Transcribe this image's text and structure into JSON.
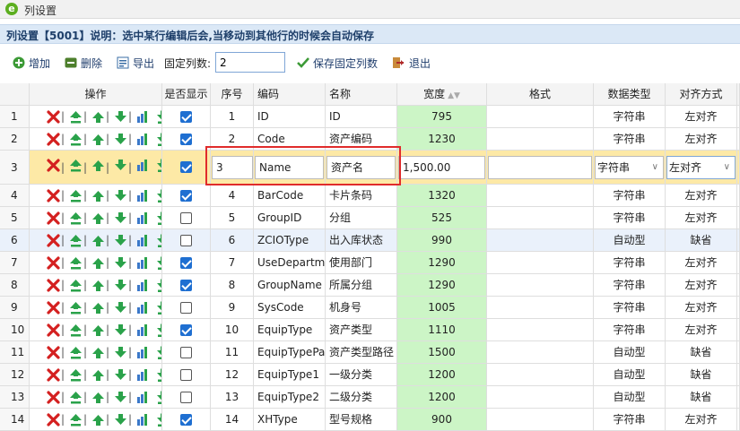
{
  "window": {
    "title": "列设置"
  },
  "info": {
    "text": "列设置【5001】说明：选中某行编辑后会,当移动到其他行的时候会自动保存"
  },
  "toolbar": {
    "add": "增加",
    "delete": "删除",
    "export": "导出",
    "fixed_label": "固定列数:",
    "fixed_value": "2",
    "save_fixed": "保存固定列数",
    "exit": "退出"
  },
  "headers": {
    "op": "操作",
    "show": "是否显示",
    "seq": "序号",
    "code": "编码",
    "name": "名称",
    "width": "宽度",
    "format": "格式",
    "datatype": "数据类型",
    "align": "对齐方式"
  },
  "rows": [
    {
      "idx": "1",
      "checked": true,
      "seq": "1",
      "code": "ID",
      "name": "ID",
      "width": "795",
      "format": "",
      "type": "字符串",
      "align": "左对齐"
    },
    {
      "idx": "2",
      "checked": true,
      "seq": "2",
      "code": "Code",
      "name": "资产编码",
      "width": "1230",
      "format": "",
      "type": "字符串",
      "align": "左对齐"
    },
    {
      "idx": "3",
      "checked": true,
      "seq": "3",
      "code": "Name",
      "name": "资产名",
      "width": "1,500.00",
      "format": "",
      "type": "字符串",
      "align": "左对齐",
      "editing": true
    },
    {
      "idx": "4",
      "checked": true,
      "seq": "4",
      "code": "BarCode",
      "name": "卡片条码",
      "width": "1320",
      "format": "",
      "type": "字符串",
      "align": "左对齐"
    },
    {
      "idx": "5",
      "checked": false,
      "seq": "5",
      "code": "GroupID",
      "name": "分组",
      "width": "525",
      "format": "",
      "type": "字符串",
      "align": "左对齐"
    },
    {
      "idx": "6",
      "checked": false,
      "seq": "6",
      "code": "ZCIOType",
      "name": "出入库状态",
      "width": "990",
      "format": "",
      "type": "自动型",
      "align": "缺省",
      "hl": true
    },
    {
      "idx": "7",
      "checked": true,
      "seq": "7",
      "code": "UseDepartm",
      "name": "使用部门",
      "width": "1290",
      "format": "",
      "type": "字符串",
      "align": "左对齐"
    },
    {
      "idx": "8",
      "checked": true,
      "seq": "8",
      "code": "GroupName",
      "name": "所属分组",
      "width": "1290",
      "format": "",
      "type": "字符串",
      "align": "左对齐"
    },
    {
      "idx": "9",
      "checked": false,
      "seq": "9",
      "code": "SysCode",
      "name": "机身号",
      "width": "1005",
      "format": "",
      "type": "字符串",
      "align": "左对齐"
    },
    {
      "idx": "10",
      "checked": true,
      "seq": "10",
      "code": "EquipType",
      "name": "资产类型",
      "width": "1110",
      "format": "",
      "type": "字符串",
      "align": "左对齐"
    },
    {
      "idx": "11",
      "checked": false,
      "seq": "11",
      "code": "EquipTypePa",
      "name": "资产类型路径",
      "width": "1500",
      "format": "",
      "type": "自动型",
      "align": "缺省"
    },
    {
      "idx": "12",
      "checked": false,
      "seq": "12",
      "code": "EquipType1",
      "name": "一级分类",
      "width": "1200",
      "format": "",
      "type": "自动型",
      "align": "缺省"
    },
    {
      "idx": "13",
      "checked": false,
      "seq": "13",
      "code": "EquipType2",
      "name": "二级分类",
      "width": "1200",
      "format": "",
      "type": "自动型",
      "align": "缺省"
    },
    {
      "idx": "14",
      "checked": true,
      "seq": "14",
      "code": "XHType",
      "name": "型号规格",
      "width": "900",
      "format": "",
      "type": "字符串",
      "align": "左对齐"
    }
  ],
  "colors": {
    "width_bg": "#ccf5c6",
    "edit_row": "#fde9a6",
    "highlight_row": "#eaf1fb",
    "info_bg": "#dbe8f6"
  }
}
